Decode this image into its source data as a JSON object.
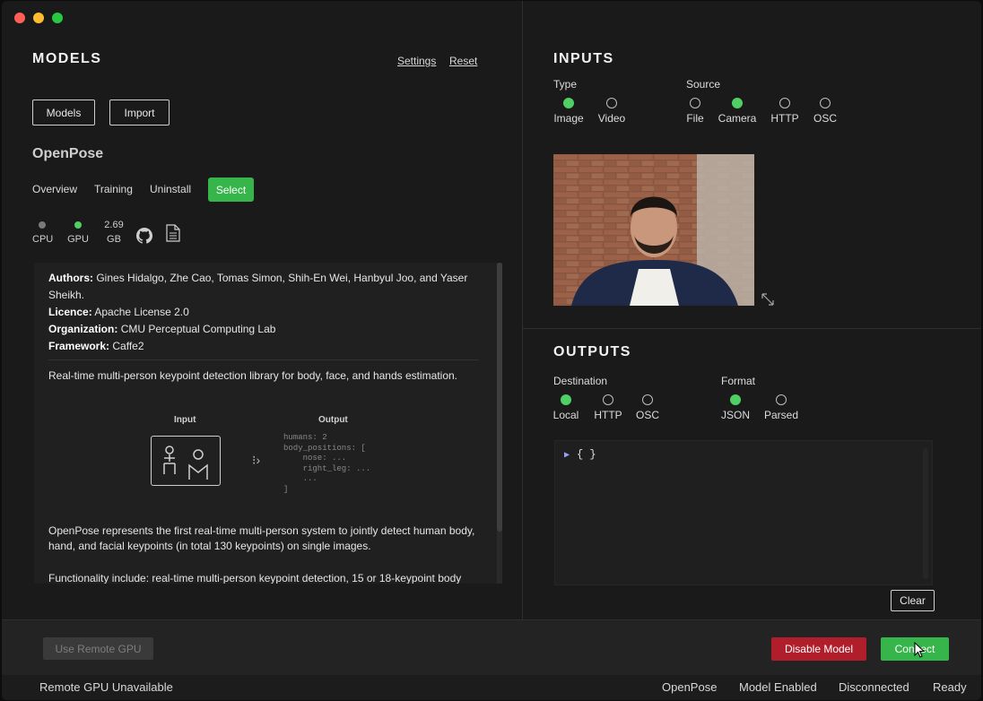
{
  "models": {
    "title": "MODELS",
    "settings_link": "Settings",
    "reset_link": "Reset",
    "models_button": "Models",
    "import_button": "Import",
    "model_name": "OpenPose",
    "tabs": [
      "Overview",
      "Training",
      "Uninstall"
    ],
    "select_button": "Select",
    "stats": {
      "cpu_label": "CPU",
      "gpu_label": "GPU",
      "size_value": "2.69",
      "size_unit": "GB",
      "github_icon": "github-icon",
      "doc_icon": "document-icon"
    },
    "info": {
      "authors_label": "Authors:",
      "authors_value": "Gines Hidalgo, Zhe Cao, Tomas Simon, Shih-En Wei, Hanbyul Joo, and Yaser Sheikh.",
      "licence_label": "Licence:",
      "licence_value": "Apache License 2.0",
      "organization_label": "Organization:",
      "organization_value": "CMU Perceptual Computing Lab",
      "framework_label": "Framework:",
      "framework_value": "Caffe2",
      "summary": "Real-time multi-person keypoint detection library for body, face, and hands estimation.",
      "diagram_input_label": "Input",
      "diagram_output_label": "Output",
      "diagram_output_code": "humans: 2\nbody_positions: [\n    nose: ...\n    right_leg: ...\n    ...\n]",
      "description": "OpenPose represents the first real-time multi-person system to jointly detect human body, hand, and facial keypoints (in total 130 keypoints) on single images.",
      "functionality": "Functionality include: real-time multi-person keypoint detection, 15 or 18-keypoint body"
    }
  },
  "inputs": {
    "title": "INPUTS",
    "type_label": "Type",
    "type_options": [
      "Image",
      "Video"
    ],
    "type_selected": "Image",
    "source_label": "Source",
    "source_options": [
      "File",
      "Camera",
      "HTTP",
      "OSC"
    ],
    "source_selected": "Camera",
    "expand_icon": "expand-icon"
  },
  "outputs": {
    "title": "OUTPUTS",
    "destination_label": "Destination",
    "destination_options": [
      "Local",
      "HTTP",
      "OSC"
    ],
    "destination_selected": "Local",
    "format_label": "Format",
    "format_options": [
      "JSON",
      "Parsed"
    ],
    "format_selected": "JSON",
    "json_preview": "{ }",
    "clear_button": "Clear"
  },
  "toolbar": {
    "remote_gpu_button": "Use Remote GPU",
    "disable_model_button": "Disable Model",
    "connect_button": "Connect"
  },
  "status": {
    "remote_gpu": "Remote GPU Unavailable",
    "model": "OpenPose",
    "model_state": "Model Enabled",
    "connection": "Disconnected",
    "ready": "Ready"
  },
  "colors": {
    "accent_green": "#36b54a",
    "danger_red": "#b01e2c",
    "background": "#1a1a1a"
  }
}
